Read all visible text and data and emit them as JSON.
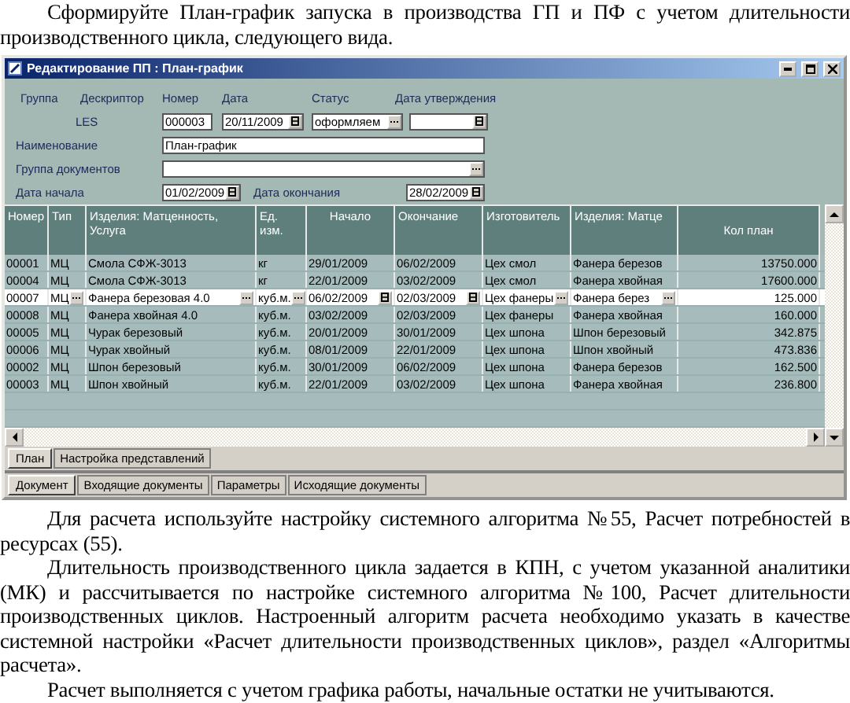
{
  "intro": "Сформируйте План-график запуска в производства ГП и ПФ с учетом длительности производственного цикла, следующего вида.",
  "window": {
    "title": "Редактирование ПП : План-график",
    "form": {
      "header_labels": [
        "Группа",
        "Дескриптор",
        "Номер",
        "Дата",
        "Статус",
        "Дата утверждения"
      ],
      "descriptor": "LES",
      "number": "000003",
      "date": "20/11/2009",
      "status": "оформляем",
      "name_label": "Наименование",
      "name": "План-график",
      "group_label": "Группа документов",
      "start_label": "Дата начала",
      "start": "01/02/2009",
      "end_label": "Дата окончания",
      "end": "28/02/2009"
    },
    "table": {
      "columns": [
        {
          "label": "Номер",
          "kind": "text"
        },
        {
          "label": "Тип",
          "kind": "lookup"
        },
        {
          "label": "Изделия: Матценность, Услуга",
          "kind": "lookup"
        },
        {
          "label": "Ед. изм.",
          "kind": "lookup"
        },
        {
          "label": "Начало",
          "kind": "date"
        },
        {
          "label": "Окончание",
          "kind": "date"
        },
        {
          "label": "Изготовитель",
          "kind": "lookup"
        },
        {
          "label": "Изделия: Матце",
          "kind": "lookup"
        },
        {
          "label": "Кол план",
          "kind": "number"
        }
      ],
      "rows": [
        {
          "cells": [
            "00001",
            "МЦ",
            "Смола СФЖ-3013",
            "кг",
            "29/01/2009",
            "06/02/2009",
            "Цех смол",
            "Фанера березов",
            "13750.000"
          ],
          "selected": false
        },
        {
          "cells": [
            "00004",
            "МЦ",
            "Смола СФЖ-3013",
            "кг",
            "22/01/2009",
            "03/02/2009",
            "Цех смол",
            "Фанера хвойная",
            "17600.000"
          ],
          "selected": false
        },
        {
          "cells": [
            "00007",
            "МЦ",
            "Фанера березовая 4.0",
            "куб.м.",
            "06/02/2009",
            "02/03/2009",
            "Цех фанеры",
            "Фанера берез",
            "125.000"
          ],
          "selected": true
        },
        {
          "cells": [
            "00008",
            "МЦ",
            "Фанера хвойная 4.0",
            "куб.м.",
            "03/02/2009",
            "02/03/2009",
            "Цех фанеры",
            "Фанера хвойная",
            "160.000"
          ],
          "selected": false
        },
        {
          "cells": [
            "00005",
            "МЦ",
            "Чурак березовый",
            "куб.м.",
            "20/01/2009",
            "30/01/2009",
            "Цех шпона",
            "Шпон березовый",
            "342.875"
          ],
          "selected": false
        },
        {
          "cells": [
            "00006",
            "МЦ",
            "Чурак хвойный",
            "куб.м.",
            "08/01/2009",
            "22/01/2009",
            "Цех шпона",
            "Шпон хвойный",
            "473.836"
          ],
          "selected": false
        },
        {
          "cells": [
            "00002",
            "МЦ",
            "Шпон березовый",
            "куб.м.",
            "30/01/2009",
            "06/02/2009",
            "Цех шпона",
            "Фанера березов",
            "162.500"
          ],
          "selected": false
        },
        {
          "cells": [
            "00003",
            "МЦ",
            "Шпон хвойный",
            "куб.м.",
            "22/01/2009",
            "03/02/2009",
            "Цех шпона",
            "Фанера хвойная",
            "236.800"
          ],
          "selected": false
        }
      ]
    },
    "view_tabs": [
      {
        "label": "План",
        "selected": true
      },
      {
        "label": "Настройка представлений",
        "selected": false
      }
    ],
    "doc_tabs": [
      {
        "label": "Документ",
        "selected": true
      },
      {
        "label": "Входящие документы",
        "selected": false
      },
      {
        "label": "Параметры",
        "selected": false
      },
      {
        "label": "Исходящие документы",
        "selected": false
      }
    ]
  },
  "paragraphs": [
    "Для расчета используйте настройку системного алгоритма №55, Расчет потребностей в ресурсах (55).",
    "Длительность производственного цикла задается в КПН, с учетом указанной аналитики (МК) и рассчитывается по настройке системного алгоритма №100, Расчет длительности производственных циклов. Настроенный алгоритм расчета необходимо указать в качестве системной настройки «Расчет длительности производственных циклов», раздел «Алгоритмы расчета».",
    "Расчет выполняется с учетом графика работы, начальные остатки не учитываются."
  ]
}
